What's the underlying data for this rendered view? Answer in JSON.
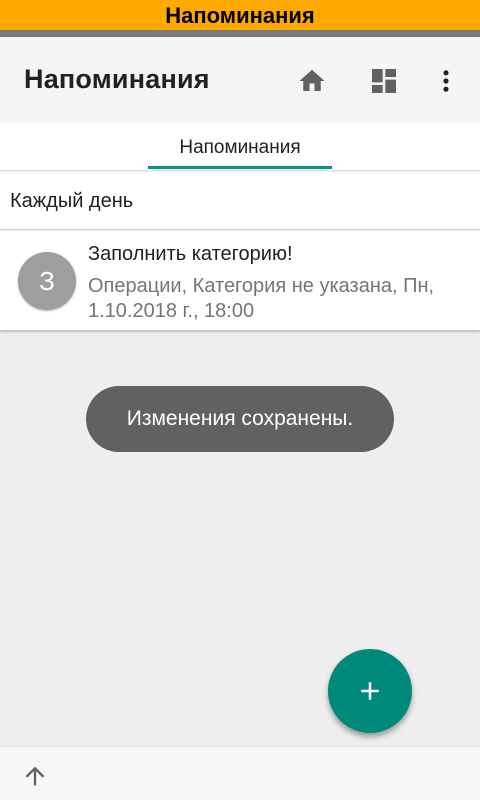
{
  "window": {
    "title": "Напоминания"
  },
  "toolbar": {
    "title": "Напоминания",
    "icons": {
      "home": "home-icon",
      "dashboard": "dashboard-icon",
      "more": "more-vert-icon"
    }
  },
  "tabs": [
    {
      "label": "Напоминания",
      "selected": true
    }
  ],
  "section": {
    "header": "Каждый день"
  },
  "reminders": [
    {
      "avatar_letter": "З",
      "title": "Заполнить категорию!",
      "subtitle": "Операции, Категория не указана, Пн, 1.10.2018 г., 18:00"
    }
  ],
  "toast": {
    "message": "Изменения сохранены."
  },
  "fab": {
    "icon": "plus-icon"
  },
  "bottom": {
    "icon": "arrow-up-icon"
  },
  "colors": {
    "banner": "#ffa800",
    "accent": "#009688",
    "fab": "#00897b",
    "toast": "#616161"
  }
}
